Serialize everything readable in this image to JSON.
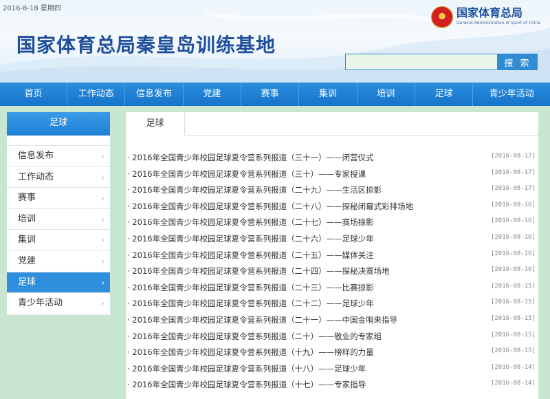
{
  "header": {
    "date_text": "2016-8-18 星期四",
    "site_title": "国家体育总局秦皇岛训练基地",
    "logo_cn": "国家体育总局",
    "logo_en": "General Administration of Sport of China",
    "search_placeholder": "",
    "search_button": "搜 索"
  },
  "nav": [
    "首页",
    "工作动态",
    "信息发布",
    "党建",
    "赛事",
    "集训",
    "培训",
    "足球",
    "青少年活动"
  ],
  "sidebar": {
    "title": "足球",
    "items": [
      {
        "label": "信息发布",
        "active": false
      },
      {
        "label": "工作动态",
        "active": false
      },
      {
        "label": "赛事",
        "active": false
      },
      {
        "label": "培训",
        "active": false
      },
      {
        "label": "集训",
        "active": false
      },
      {
        "label": "党建",
        "active": false
      },
      {
        "label": "足球",
        "active": true
      },
      {
        "label": "青少年活动",
        "active": false
      }
    ]
  },
  "main": {
    "tab_label": "足球",
    "news": [
      {
        "title": "2016年全国青少年校园足球夏令营系列报道（三十一）——闭营仪式",
        "date": "[2016-08-17]"
      },
      {
        "title": "2016年全国青少年校园足球夏令营系列报道（三十）——专家授课",
        "date": "[2016-08-17]"
      },
      {
        "title": "2016年全国青少年校园足球夏令营系列报道（二十九）——生活区掠影",
        "date": "[2016-08-17]"
      },
      {
        "title": "2016年全国青少年校园足球夏令营系列报道（二十八）——探秘闭幕式彩排场地",
        "date": "[2016-08-16]"
      },
      {
        "title": "2016年全国青少年校园足球夏令营系列报道（二十七）——赛场掠影",
        "date": "[2016-08-16]"
      },
      {
        "title": "2016年全国青少年校园足球夏令营系列报道（二十六）——足球少年",
        "date": "[2016-08-16]"
      },
      {
        "title": "2016年全国青少年校园足球夏令营系列报道（二十五）——媒体关注",
        "date": "[2016-08-16]"
      },
      {
        "title": "2016年全国青少年校园足球夏令营系列报道（二十四）——探秘决赛场地",
        "date": "[2016-08-16]"
      },
      {
        "title": "2016年全国青少年校园足球夏令营系列报道（二十三）——比赛掠影",
        "date": "[2016-08-15]"
      },
      {
        "title": "2016年全国青少年校园足球夏令营系列报道（二十二）——足球少年",
        "date": "[2016-08-15]"
      },
      {
        "title": "2016年全国青少年校园足球夏令营系列报道（二十一）——中国金哨来指导",
        "date": "[2016-08-15]"
      },
      {
        "title": "2016年全国青少年校园足球夏令营系列报道（二十）——敬业的专家组",
        "date": "[2016-08-15]"
      },
      {
        "title": "2016年全国青少年校园足球夏令营系列报道（十九）——榜样的力量",
        "date": "[2016-08-15]"
      },
      {
        "title": "2016年全国青少年校园足球夏令营系列报道（十八）——足球少年",
        "date": "[2016-08-14]"
      },
      {
        "title": "2016年全国青少年校园足球夏令营系列报道（十七）——专家指导",
        "date": "[2016-08-14]"
      }
    ]
  },
  "colors": {
    "brand_blue": "#1f4f9c",
    "nav_blue": "#1673c9",
    "active_blue": "#2f8fde",
    "page_bg": "#c9e6d2"
  }
}
